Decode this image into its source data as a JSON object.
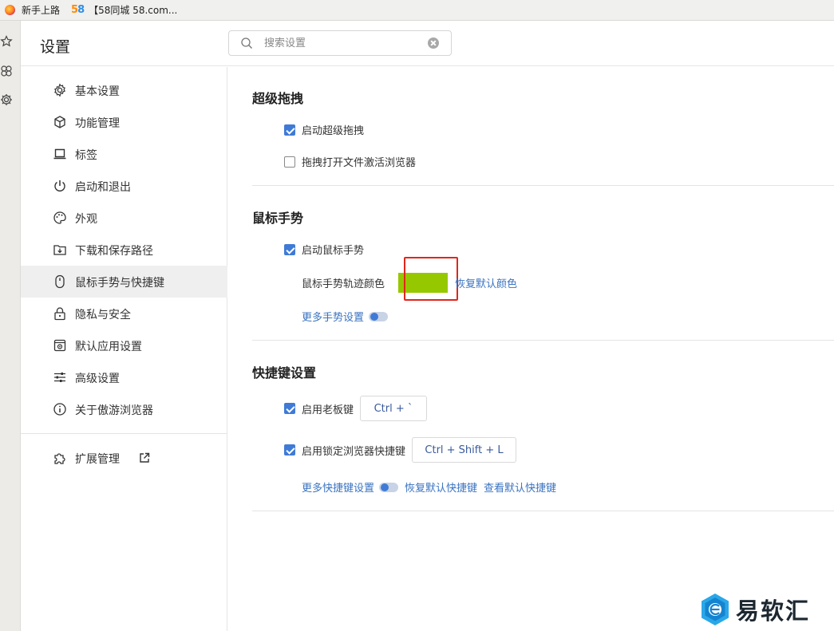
{
  "bookmarks": [
    {
      "label": "新手上路"
    },
    {
      "label": "【58同城 58.com..."
    }
  ],
  "bookmark_58_logo": {
    "part1": "5",
    "part2": "8"
  },
  "header": {
    "title": "设置",
    "search_placeholder": "搜索设置"
  },
  "sidebar": {
    "items": [
      {
        "label": "基本设置",
        "icon": "gear-icon"
      },
      {
        "label": "功能管理",
        "icon": "cube-icon"
      },
      {
        "label": "标签",
        "icon": "tab-icon"
      },
      {
        "label": "启动和退出",
        "icon": "power-icon"
      },
      {
        "label": "外观",
        "icon": "palette-icon"
      },
      {
        "label": "下载和保存路径",
        "icon": "download-folder-icon"
      },
      {
        "label": "鼠标手势与快捷键",
        "icon": "mouse-icon",
        "active": true
      },
      {
        "label": "隐私与安全",
        "icon": "lock-icon"
      },
      {
        "label": "默认应用设置",
        "icon": "default-app-icon"
      },
      {
        "label": "高级设置",
        "icon": "sliders-icon"
      },
      {
        "label": "关于傲游浏览器",
        "icon": "info-icon"
      }
    ],
    "extensions": {
      "label": "扩展管理",
      "icon": "puzzle-icon"
    }
  },
  "main": {
    "drag": {
      "title": "超级拖拽",
      "enable_label": "启动超级拖拽",
      "enable_checked": true,
      "activate_label": "拖拽打开文件激活浏览器",
      "activate_checked": false
    },
    "gesture": {
      "title": "鼠标手势",
      "enable_label": "启动鼠标手势",
      "enable_checked": true,
      "color_label": "鼠标手势轨迹颜色",
      "trail_color": "#96c800",
      "reset_color_link": "恢复默认颜色",
      "more_link": "更多手势设置"
    },
    "shortcuts": {
      "title": "快捷键设置",
      "boss_label": "启用老板键",
      "boss_checked": true,
      "boss_key": "Ctrl + `",
      "lock_label": "启用锁定浏览器快捷键",
      "lock_checked": true,
      "lock_key": "Ctrl + Shift + L",
      "more_link": "更多快捷键设置",
      "reset_link": "恢复默认快捷键",
      "view_link": "查看默认快捷键"
    }
  },
  "watermark": {
    "text": "易软汇"
  },
  "colors": {
    "accent": "#3f7bd6",
    "link": "#3a73c0",
    "highlight": "#e0261c"
  }
}
